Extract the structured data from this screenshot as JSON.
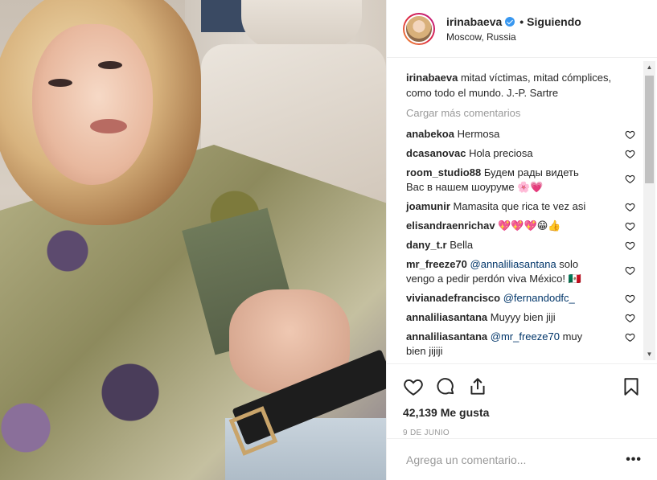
{
  "post": {
    "username": "irinabaeva",
    "follow_separator": "•",
    "follow_status": "Siguiendo",
    "location": "Moscow, Russia",
    "caption_user": "irinabaeva",
    "caption_text": "mitad víctimas, mitad cómplices,",
    "caption_text2": "como todo el mundo. J.-P. Sartre",
    "load_more": "Cargar más comentarios",
    "likes": "42,139 Me gusta",
    "date": "9 DE JUNIO",
    "comment_placeholder": "Agrega un comentario...",
    "more_icon": "•••"
  },
  "comments": [
    {
      "user": "anabekoa",
      "text": "Hermosa"
    },
    {
      "user": "dcasanovac",
      "text": "Hola preciosa"
    },
    {
      "user": "room_studio88",
      "text": "Будем рады видеть Вас в нашем шоуруме 🌸💗"
    },
    {
      "user": "joamunir",
      "text": "Mamasita que rica te vez asi"
    },
    {
      "user": "elisandraenrichav",
      "text": "💖💖💖😁👍"
    },
    {
      "user": "dany_t.r",
      "text": "Bella"
    },
    {
      "user": "mr_freeze70",
      "mention": "@annaliliasantana",
      "text": " solo vengo a pedir perdón viva México! 🇲🇽"
    },
    {
      "user": "vivianadefrancisco",
      "mention": "@fernandodfc_",
      "text": ""
    },
    {
      "user": "annaliliasantana",
      "text": "Muyyy bien jiji"
    },
    {
      "user": "annaliliasantana",
      "mention": "@mr_freeze70",
      "text": " muy bien jijiji"
    }
  ],
  "icons": {
    "like": "heart-icon",
    "comment": "comment-icon",
    "share": "share-icon",
    "save": "bookmark-icon",
    "verified": "verified-badge-icon",
    "comment_like": "small-heart-icon"
  },
  "colors": {
    "verified_blue": "#3897f0",
    "text": "#262626",
    "muted": "#999999",
    "mention": "#003569"
  }
}
